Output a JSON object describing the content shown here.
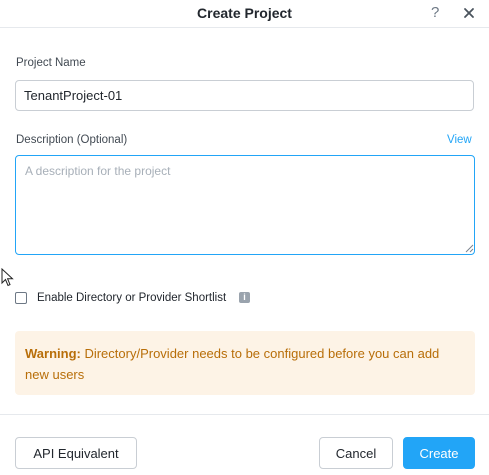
{
  "dialog": {
    "title": "Create Project",
    "help_glyph": "?",
    "icons": {
      "help": "question-mark-icon",
      "close": "close-icon"
    }
  },
  "form": {
    "project_name_label": "Project Name",
    "project_name_value": "TenantProject-01",
    "description_label": "Description (Optional)",
    "description_placeholder": "A description for the project",
    "description_value": "",
    "view_link": "View",
    "shortlist_label": "Enable Directory or Provider Shortlist",
    "shortlist_checked": false,
    "info_glyph": "i"
  },
  "warning": {
    "prefix": "Warning:",
    "message": " Directory/Provider needs to be configured before you can add new users"
  },
  "footer": {
    "api_label": "API Equivalent",
    "cancel_label": "Cancel",
    "create_label": "Create"
  },
  "colors": {
    "accent": "#22a5f7",
    "warning_bg": "#fdf3e6",
    "warning_text": "#b86e09"
  }
}
